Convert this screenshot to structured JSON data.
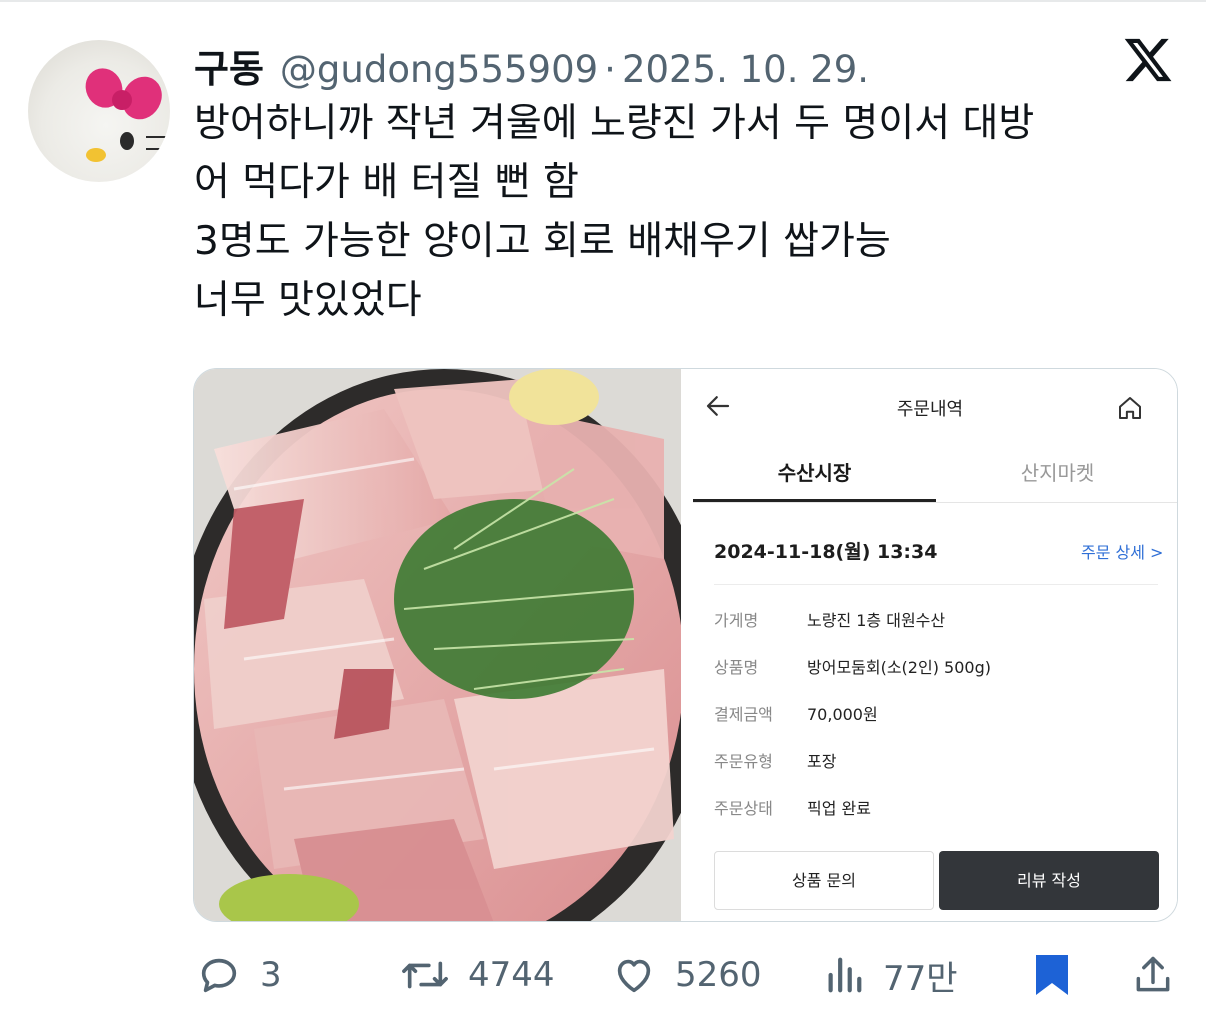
{
  "author": {
    "display_name": "구동",
    "handle": "@gudong555909",
    "separator": "·",
    "date": "2025. 10. 29."
  },
  "tweet": {
    "lines": [
      "방어하니까 작년 겨울에 노량진 가서 두 명이서 대방",
      "어 먹다가 배 터질 뻔 함",
      "3명도 가능한 양이고 회로 배채우기 쌉가능",
      "너무 맛있었다"
    ]
  },
  "order_screen": {
    "title": "주문내역",
    "tabs": [
      {
        "label": "수산시장",
        "active": true
      },
      {
        "label": "산지마켓",
        "active": false
      }
    ],
    "date": "2024-11-18(월) 13:34",
    "detail_link": "주문 상세 >",
    "fields": [
      {
        "key": "가게명",
        "value": "노량진 1층 대원수산"
      },
      {
        "key": "상품명",
        "value": "방어모둠회(소(2인) 500g)"
      },
      {
        "key": "결제금액",
        "value": "70,000원"
      },
      {
        "key": "주문유형",
        "value": "포장"
      },
      {
        "key": "주문상태",
        "value": "픽업 완료"
      }
    ],
    "buttons": {
      "inquiry": "상품 문의",
      "review": "리뷰 작성"
    }
  },
  "actions": {
    "replies": "3",
    "retweets": "4744",
    "likes": "5260",
    "views": "77만"
  },
  "colors": {
    "text_primary": "#0f1419",
    "text_secondary": "#536471",
    "bookmark_active": "#1d62d6",
    "link_blue": "#2f6fd6",
    "dark_button": "#33363a"
  },
  "icons": [
    "x-logo-icon",
    "back-arrow-icon",
    "home-icon",
    "reply-icon",
    "retweet-icon",
    "like-icon",
    "views-icon",
    "bookmark-icon",
    "share-icon"
  ]
}
